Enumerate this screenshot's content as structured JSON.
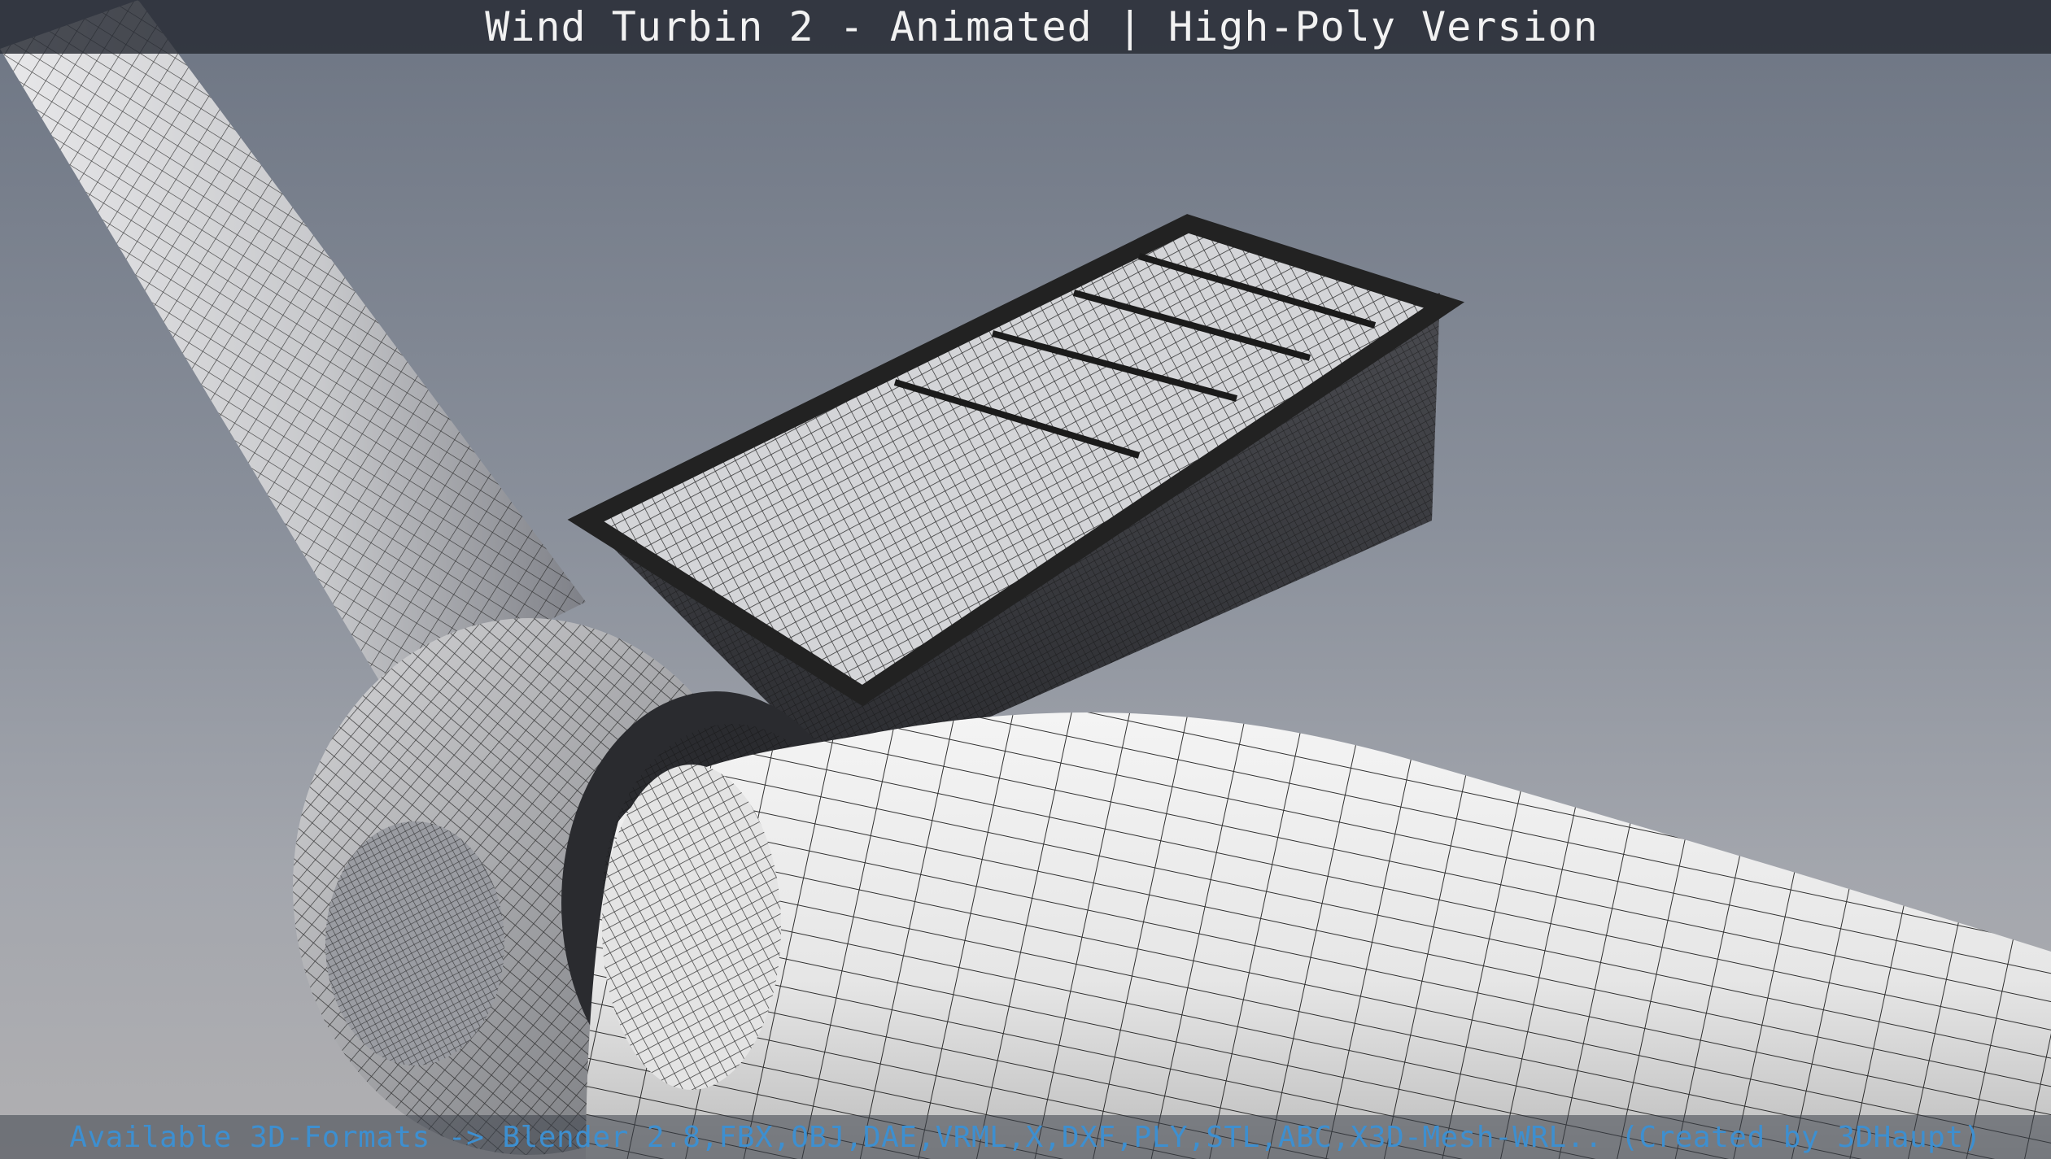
{
  "header": {
    "title": "Wind Turbin 2 - Animated | High-Poly Version"
  },
  "footer": {
    "formats_text": "Available 3D-Formats -> Blender 2.8,FBX,OBJ,DAE,VRML,X,DXF,PLY,STL,ABC,X3D-Mesh-WRL.. (Created by 3DHaupt)"
  },
  "colors": {
    "background_top": "#6d7583",
    "background_bottom": "#b1b0b2",
    "title_text": "#f2f2f2",
    "footer_text": "#3d8fd0"
  }
}
